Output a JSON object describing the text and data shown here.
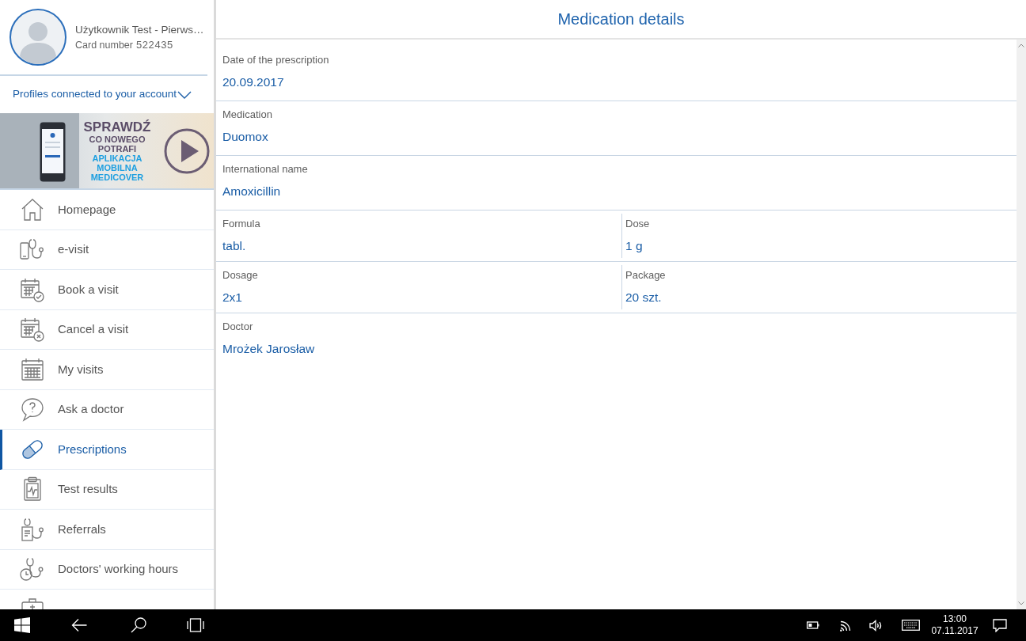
{
  "profile": {
    "name": "Użytkownik Test - Pierws…",
    "card_label": "Card number",
    "card_number": "522435"
  },
  "profiles_toggle": {
    "label": "Profiles connected to your account",
    "expanded": false
  },
  "banner": {
    "lines": [
      {
        "text": "SPRAWDŹ",
        "kind": "headline"
      },
      {
        "text": "CO NOWEGO",
        "kind": "tagline"
      },
      {
        "text": "POTRAFI",
        "kind": "tagline"
      },
      {
        "text": "APLIKACJA",
        "kind": "brand"
      },
      {
        "text": "MOBILNA",
        "kind": "brand"
      },
      {
        "text": "MEDICOVER",
        "kind": "brand"
      }
    ]
  },
  "sidebar": {
    "items": [
      {
        "label": "Homepage",
        "selected": false
      },
      {
        "label": "e-visit",
        "selected": false
      },
      {
        "label": "Book a visit",
        "selected": false
      },
      {
        "label": "Cancel a visit",
        "selected": false
      },
      {
        "label": "My visits",
        "selected": false
      },
      {
        "label": "Ask a doctor",
        "selected": false
      },
      {
        "label": "Prescriptions",
        "selected": true
      },
      {
        "label": "Test results",
        "selected": false
      },
      {
        "label": "Referrals",
        "selected": false
      },
      {
        "label": "Doctors' working hours",
        "selected": false
      },
      {
        "selected": false
      }
    ]
  },
  "page": {
    "title": "Medication details"
  },
  "details": {
    "rows": [
      {
        "fields": [
          {
            "label": "Date of the prescription",
            "value": "20.09.2017"
          }
        ]
      },
      {
        "fields": [
          {
            "label": "Medication",
            "value": "Duomox"
          }
        ]
      },
      {
        "fields": [
          {
            "label": "International name",
            "value": "Amoxicillin"
          }
        ]
      },
      {
        "fields": [
          {
            "label": "Formula",
            "value": "tabl."
          },
          {
            "label": "Dose",
            "value": "1 g"
          }
        ]
      },
      {
        "fields": [
          {
            "label": "Dosage",
            "value": "2x1"
          },
          {
            "label": "Package",
            "value": "20 szt."
          }
        ]
      },
      {
        "fields": [
          {
            "label": "Doctor",
            "value": "Mrożek Jarosław"
          }
        ]
      }
    ]
  },
  "taskbar": {
    "time": "13:00",
    "date": "07.11.2017"
  }
}
